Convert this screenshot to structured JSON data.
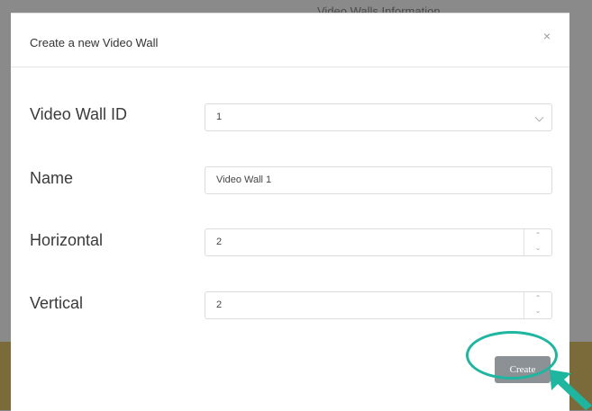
{
  "background": {
    "text": "Video Walls Information"
  },
  "dialog": {
    "title": "Create a new Video Wall",
    "close_label": "×",
    "fields": {
      "video_wall_id": {
        "label": "Video Wall ID",
        "value": "1"
      },
      "name": {
        "label": "Name",
        "value": "Video Wall 1"
      },
      "horizontal": {
        "label": "Horizontal",
        "value": "2"
      },
      "vertical": {
        "label": "Vertical",
        "value": "2"
      }
    },
    "spin_up": "⌃",
    "spin_down": "⌄",
    "create_label": "Create"
  },
  "colors": {
    "accent_highlight": "#1fb6a0",
    "create_button": "#8c9196"
  },
  "icons": [
    "close-icon",
    "chevron-down-icon",
    "spin-up-icon",
    "spin-down-icon",
    "pointer-arrow-icon"
  ]
}
